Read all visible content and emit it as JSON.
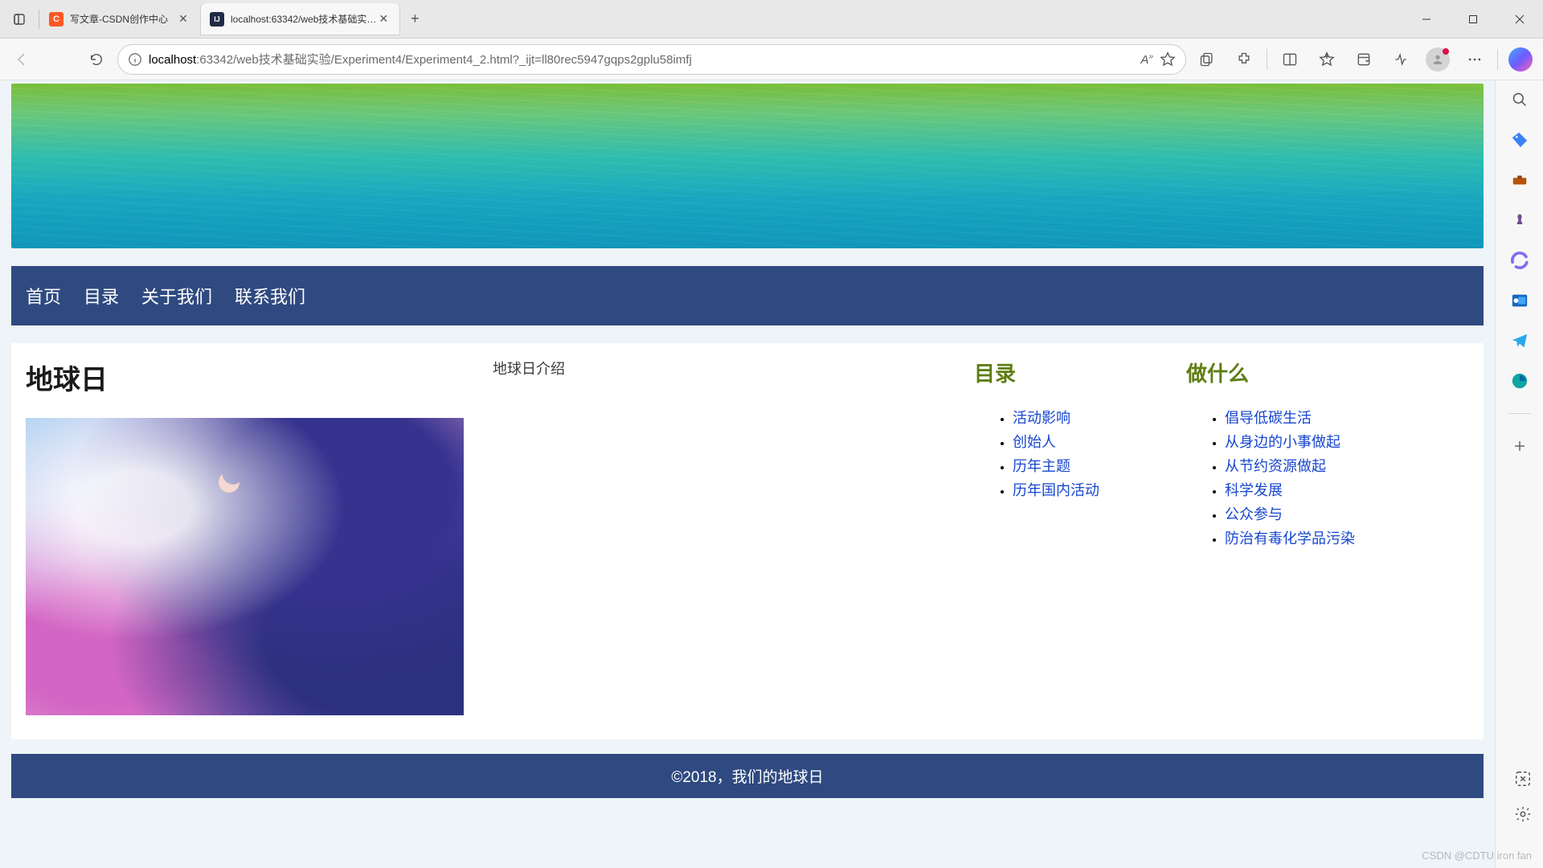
{
  "tabs": [
    {
      "favicon": "C",
      "label": "写文章-CSDN创作中心"
    },
    {
      "favicon": "IJ",
      "label": "localhost:63342/web技术基础实…"
    }
  ],
  "url": {
    "host": "localhost",
    "path": ":63342/web技术基础实验/Experiment4/Experiment4_2.html?_ijt=ll80rec5947gqps2gplu58imfj"
  },
  "nav": [
    "首页",
    "目录",
    "关于我们",
    "联系我们"
  ],
  "content": {
    "title": "地球日",
    "intro": "地球日介绍",
    "toc_title": "目录",
    "toc_items": [
      "活动影响",
      "创始人",
      "历年主题",
      "历年国内活动"
    ],
    "todo_title": "做什么",
    "todo_items": [
      "倡导低碳生活",
      "从身边的小事做起",
      "从节约资源做起",
      "科学发展",
      "公众参与",
      "防治有毒化学品污染"
    ],
    "footer": "©2018，我们的地球日"
  },
  "watermark": "CSDN @CDTU iron fan"
}
